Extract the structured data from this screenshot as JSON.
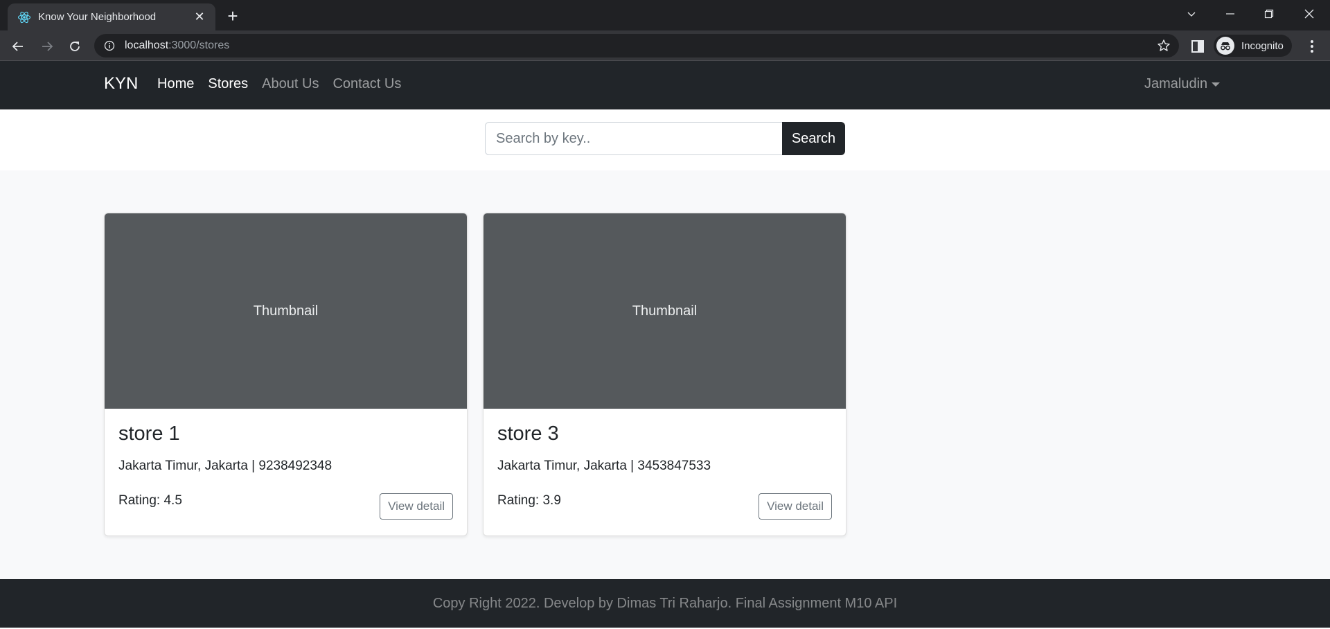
{
  "browser": {
    "tab_title": "Know Your Neighborhood",
    "url_host": "localhost",
    "url_path": ":3000/stores",
    "profile_label": "Incognito"
  },
  "navbar": {
    "brand": "KYN",
    "links": [
      {
        "label": "Home",
        "active": true
      },
      {
        "label": "Stores",
        "active": true
      },
      {
        "label": "About Us",
        "active": false
      },
      {
        "label": "Contact Us",
        "active": false
      }
    ],
    "user": "Jamaludin"
  },
  "search": {
    "placeholder": "Search by key..",
    "button_label": "Search"
  },
  "stores": [
    {
      "thumbnail": "Thumbnail",
      "name": "store 1",
      "address": "Jakarta Timur, Jakarta | 9238492348",
      "rating": "Rating: 4.5",
      "button": "View detail"
    },
    {
      "thumbnail": "Thumbnail",
      "name": "store 3",
      "address": "Jakarta Timur, Jakarta | 3453847533",
      "rating": "Rating: 3.9",
      "button": "View detail"
    }
  ],
  "footer": {
    "text": "Copy Right 2022. Develop by Dimas Tri Raharjo. Final Assignment M10 API"
  },
  "colors": {
    "navbar_bg": "#212529",
    "thumbnail_bg": "#55595c",
    "page_bg": "#f8f9fa"
  }
}
